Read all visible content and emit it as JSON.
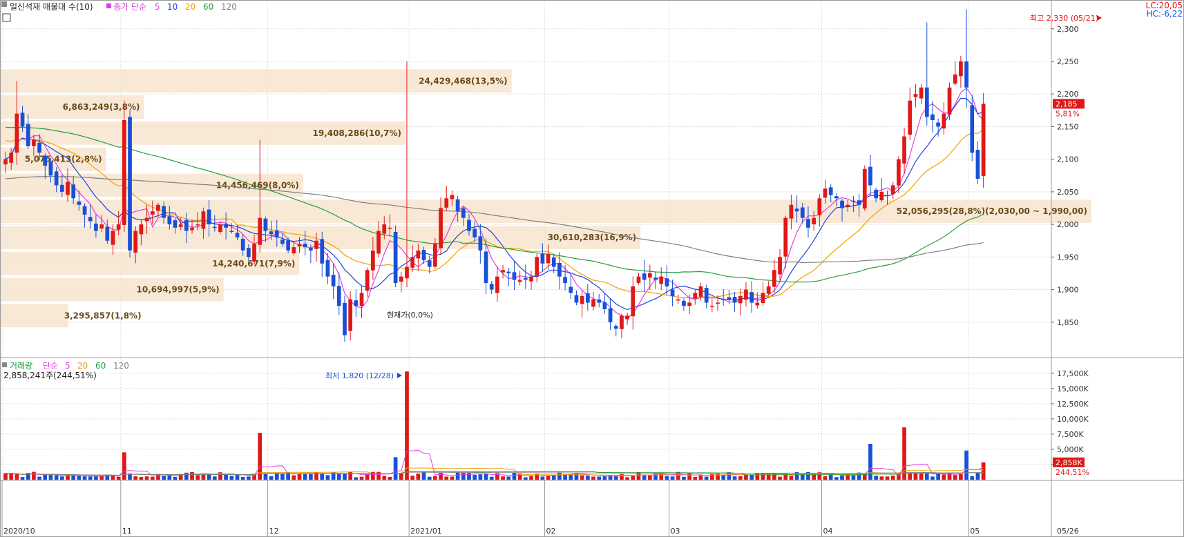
{
  "legend": {
    "title": "일신석재 매물대 수(10)",
    "ma_label": "종가 단순",
    "ma_items": [
      {
        "label": "5",
        "color": "#e040e0"
      },
      {
        "label": "10",
        "color": "#2040e0"
      },
      {
        "label": "20",
        "color": "#f0a000"
      },
      {
        "label": "60",
        "color": "#20a040"
      },
      {
        "label": "120",
        "color": "#808080"
      }
    ],
    "lc": "LC:20,05",
    "hc": "HC:-6,22"
  },
  "volume_legend": {
    "title": "거래량",
    "ma_label": "단순",
    "ma_items": [
      {
        "label": "5",
        "color": "#e040e0"
      },
      {
        "label": "20",
        "color": "#f0a000"
      },
      {
        "label": "60",
        "color": "#20a040"
      },
      {
        "label": "120",
        "color": "#808080"
      }
    ],
    "value": "2,858,241주(244,51%)"
  },
  "annotations": {
    "high": "최고 2,330 (05/21)",
    "low": "최저 1,820 (12/28)",
    "current_price": "2,185",
    "current_change": "5,81%",
    "current_volume": "2,858K",
    "current_volume_pct": "244,51%",
    "current_vp_label": "현재가(0,0%)",
    "last_date": "05/26"
  },
  "chart_data": {
    "type": "candlestick",
    "price_axis": {
      "ylim": [
        1800,
        2340
      ],
      "ticks": [
        "2,300",
        "2,250",
        "2,200",
        "2,150",
        "2,100",
        "2,050",
        "2,000",
        "1,950",
        "1,900",
        "1,850"
      ]
    },
    "volume_axis": {
      "ylim": [
        0,
        18500
      ],
      "ticks": [
        "17,500K",
        "15,000K",
        "12,500K",
        "10,000K",
        "7,500K",
        "5,000K",
        "2,500K"
      ]
    },
    "x_labels": [
      {
        "label": "2020/10",
        "index": 0
      },
      {
        "label": "11",
        "index": 21
      },
      {
        "label": "12",
        "index": 47
      },
      {
        "label": "2021/01",
        "index": 72
      },
      {
        "label": "02",
        "index": 96
      },
      {
        "label": "03",
        "index": 118
      },
      {
        "label": "04",
        "index": 145
      },
      {
        "label": "05",
        "index": 171
      }
    ],
    "volume_profile": [
      {
        "low": 2200,
        "high": 2240,
        "label": "24,429,468(13,5%)",
        "share": 13.5
      },
      {
        "low": 2160,
        "high": 2200,
        "label": "6,863,249(3,8%)",
        "share": 3.8
      },
      {
        "low": 2120,
        "high": 2160,
        "label": "19,408,286(10,7%)",
        "share": 10.7
      },
      {
        "low": 2080,
        "high": 2120,
        "label": "5,075,413(2,8%)",
        "share": 2.8
      },
      {
        "low": 2040,
        "high": 2080,
        "label": "14,456,469(8,0%)",
        "share": 8.0
      },
      {
        "low": 2000,
        "high": 2040,
        "label": "52,056,295(28,8%)(2,030,00 ~ 1,990,00)",
        "share": 28.8
      },
      {
        "low": 1960,
        "high": 2000,
        "label": "30,610,283(16,9%)",
        "share": 16.9
      },
      {
        "low": 1920,
        "high": 1960,
        "label": "14,240,671(7,9%)",
        "share": 7.9
      },
      {
        "low": 1880,
        "high": 1920,
        "label": "10,694,997(5,9%)",
        "share": 5.9
      },
      {
        "low": 1840,
        "high": 1880,
        "label": "3,295,857(1,8%)",
        "share": 1.8
      }
    ],
    "price_anchors": [
      [
        0,
        2100
      ],
      [
        1,
        2110
      ],
      [
        2,
        2170
      ],
      [
        3,
        2150
      ],
      [
        4,
        2120
      ],
      [
        5,
        2130
      ],
      [
        6,
        2110
      ],
      [
        7,
        2090
      ],
      [
        8,
        2075
      ],
      [
        9,
        2060
      ],
      [
        10,
        2050
      ],
      [
        11,
        2065
      ],
      [
        12,
        2040
      ],
      [
        13,
        2030
      ],
      [
        14,
        2015
      ],
      [
        15,
        2005
      ],
      [
        16,
        1990
      ],
      [
        17,
        2000
      ],
      [
        18,
        1975
      ],
      [
        19,
        1990
      ],
      [
        20,
        2000
      ],
      [
        21,
        2160
      ],
      [
        22,
        1960
      ],
      [
        23,
        1990
      ],
      [
        24,
        2000
      ],
      [
        25,
        2010
      ],
      [
        26,
        2020
      ],
      [
        27,
        2030
      ],
      [
        28,
        2010
      ],
      [
        29,
        2000
      ],
      [
        30,
        1995
      ],
      [
        31,
        2000
      ],
      [
        32,
        1990
      ],
      [
        33,
        1995
      ],
      [
        34,
        2000
      ],
      [
        35,
        2020
      ],
      [
        36,
        2000
      ],
      [
        37,
        1995
      ],
      [
        38,
        2000
      ],
      [
        39,
        1995
      ],
      [
        40,
        1990
      ],
      [
        41,
        1980
      ],
      [
        42,
        1960
      ],
      [
        43,
        1950
      ],
      [
        44,
        1970
      ],
      [
        45,
        2010
      ],
      [
        46,
        1990
      ],
      [
        47,
        1985
      ],
      [
        48,
        1980
      ],
      [
        49,
        1970
      ],
      [
        50,
        1960
      ],
      [
        51,
        1965
      ],
      [
        52,
        1970
      ],
      [
        53,
        1965
      ],
      [
        54,
        1960
      ],
      [
        55,
        1975
      ],
      [
        56,
        1940
      ],
      [
        57,
        1920
      ],
      [
        58,
        1905
      ],
      [
        59,
        1875
      ],
      [
        60,
        1830
      ],
      [
        61,
        1885
      ],
      [
        62,
        1875
      ],
      [
        63,
        1895
      ],
      [
        64,
        1930
      ],
      [
        65,
        1960
      ],
      [
        66,
        1990
      ],
      [
        67,
        2000
      ],
      [
        68,
        1995
      ],
      [
        69,
        1910
      ],
      [
        70,
        1920
      ],
      [
        71,
        1935
      ],
      [
        72,
        1950
      ],
      [
        73,
        1960
      ],
      [
        74,
        1945
      ],
      [
        75,
        1935
      ],
      [
        76,
        1970
      ],
      [
        77,
        2025
      ],
      [
        78,
        2040
      ],
      [
        79,
        2045
      ],
      [
        80,
        2020
      ],
      [
        81,
        2010
      ],
      [
        82,
        1990
      ],
      [
        83,
        1980
      ],
      [
        84,
        1960
      ],
      [
        85,
        1910
      ],
      [
        86,
        1900
      ],
      [
        87,
        1920
      ],
      [
        88,
        1930
      ],
      [
        89,
        1925
      ],
      [
        90,
        1915
      ],
      [
        91,
        1915
      ],
      [
        92,
        1915
      ],
      [
        93,
        1920
      ],
      [
        94,
        1950
      ],
      [
        95,
        1940
      ],
      [
        96,
        1955
      ],
      [
        97,
        1935
      ],
      [
        98,
        1920
      ],
      [
        99,
        1910
      ],
      [
        100,
        1895
      ],
      [
        101,
        1880
      ],
      [
        102,
        1890
      ],
      [
        103,
        1880
      ],
      [
        104,
        1885
      ],
      [
        105,
        1880
      ],
      [
        106,
        1870
      ],
      [
        107,
        1850
      ],
      [
        108,
        1840
      ],
      [
        109,
        1860
      ],
      [
        110,
        1860
      ],
      [
        111,
        1905
      ],
      [
        112,
        1920
      ],
      [
        113,
        1915
      ],
      [
        114,
        1925
      ],
      [
        115,
        1915
      ],
      [
        116,
        1920
      ],
      [
        117,
        1905
      ],
      [
        118,
        1890
      ],
      [
        119,
        1885
      ],
      [
        120,
        1875
      ],
      [
        121,
        1880
      ],
      [
        122,
        1895
      ],
      [
        123,
        1905
      ],
      [
        124,
        1880
      ],
      [
        125,
        1875
      ],
      [
        126,
        1880
      ],
      [
        127,
        1885
      ],
      [
        128,
        1885
      ],
      [
        129,
        1880
      ],
      [
        130,
        1890
      ],
      [
        131,
        1900
      ],
      [
        132,
        1880
      ],
      [
        133,
        1880
      ],
      [
        134,
        1895
      ],
      [
        135,
        1905
      ],
      [
        136,
        1930
      ],
      [
        137,
        1950
      ],
      [
        138,
        2010
      ],
      [
        139,
        2030
      ],
      [
        140,
        2020
      ],
      [
        141,
        2010
      ],
      [
        142,
        1995
      ],
      [
        143,
        2010
      ],
      [
        144,
        2040
      ],
      [
        145,
        2055
      ],
      [
        146,
        2045
      ],
      [
        147,
        2040
      ],
      [
        148,
        2025
      ],
      [
        149,
        2030
      ],
      [
        150,
        2035
      ],
      [
        151,
        2030
      ],
      [
        152,
        2085
      ],
      [
        153,
        2060
      ],
      [
        154,
        2040
      ],
      [
        155,
        2050
      ],
      [
        156,
        2045
      ],
      [
        157,
        2060
      ],
      [
        158,
        2100
      ],
      [
        159,
        2135
      ],
      [
        160,
        2190
      ],
      [
        161,
        2200
      ],
      [
        162,
        2210
      ],
      [
        163,
        2165
      ],
      [
        164,
        2160
      ],
      [
        165,
        2150
      ],
      [
        166,
        2170
      ],
      [
        167,
        2210
      ],
      [
        168,
        2230
      ],
      [
        169,
        2250
      ],
      [
        170,
        2185
      ],
      [
        171,
        2110
      ],
      [
        172,
        2070
      ],
      [
        173,
        2185
      ]
    ],
    "candles_source": "generated from anchors",
    "volume_spikes": [
      {
        "index": 21,
        "value": 4500
      },
      {
        "index": 45,
        "value": 7700
      },
      {
        "index": 69,
        "value": 3700
      },
      {
        "index": 71,
        "value": 17800
      },
      {
        "index": 153,
        "value": 5900
      },
      {
        "index": 159,
        "value": 8600
      },
      {
        "index": 170,
        "value": 4800
      },
      {
        "index": 173,
        "value": 2858
      }
    ]
  }
}
